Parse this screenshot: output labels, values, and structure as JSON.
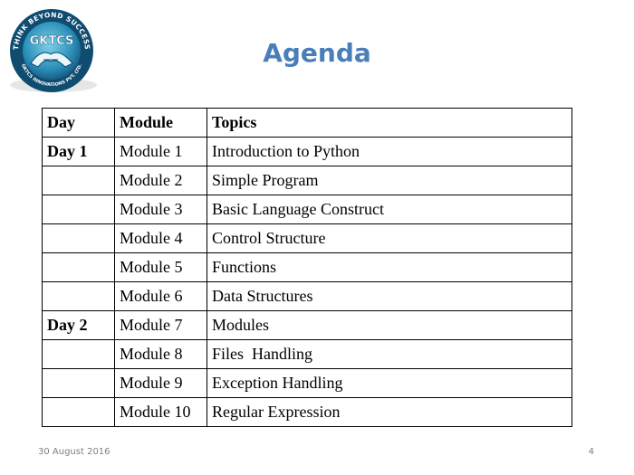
{
  "logo": {
    "name": "GKTCS",
    "ring_top": "THINK BEYOND SUCCESS",
    "ring_bottom": "GKTCS INNOVATIONS PVT. LTD."
  },
  "title": "Agenda",
  "table": {
    "headers": [
      "Day",
      "Module",
      "Topics"
    ],
    "rows": [
      {
        "day": "Day 1",
        "module": "Module 1",
        "topic": "Introduction to Python"
      },
      {
        "day": "",
        "module": "Module 2",
        "topic": "Simple Program"
      },
      {
        "day": "",
        "module": "Module 3",
        "topic": "Basic Language Construct"
      },
      {
        "day": "",
        "module": "Module 4",
        "topic": "Control Structure"
      },
      {
        "day": "",
        "module": "Module 5",
        "topic": "Functions"
      },
      {
        "day": "",
        "module": "Module 6",
        "topic": "Data Structures"
      },
      {
        "day": "Day 2",
        "module": "Module 7",
        "topic": "Modules"
      },
      {
        "day": "",
        "module": "Module 8",
        "topic": "Files  Handling"
      },
      {
        "day": "",
        "module": "Module 9",
        "topic": "Exception Handling"
      },
      {
        "day": "",
        "module": "Module 10",
        "topic": "Regular Expression"
      }
    ]
  },
  "footer": {
    "date": "30 August 2016",
    "page": "4"
  }
}
